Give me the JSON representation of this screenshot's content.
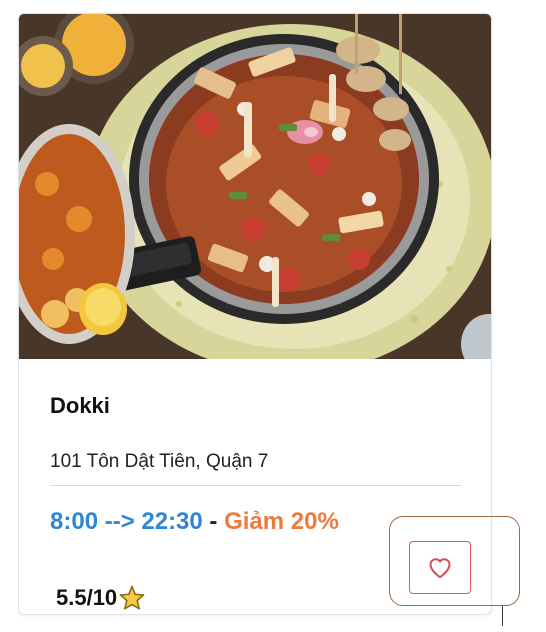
{
  "restaurant": {
    "name": "Dokki",
    "address": "101 Tôn Dật Tiên, Quận 7",
    "hours": "8:00 --> 22:30",
    "separator": " - ",
    "discount": "Giảm 20%",
    "rating": "5.5/10"
  },
  "icons": {
    "rating": "star-icon",
    "favorite": "heart-outline-icon"
  },
  "colors": {
    "hours": "#2f86d6",
    "discount": "#ee7a3b",
    "favorite_border": "#e05a5a",
    "star_fill": "#f6c944",
    "star_stroke": "#8a6a12",
    "highlight_frame": "#9b6a45"
  }
}
